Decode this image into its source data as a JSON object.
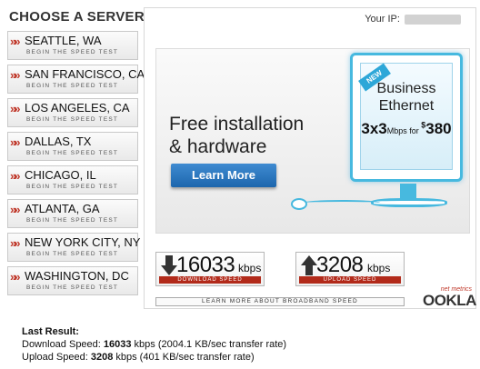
{
  "servers": {
    "title": "CHOOSE A SERVER:",
    "sub_label": "BEGIN THE SPEED TEST",
    "items": [
      {
        "city": "SEATTLE, WA"
      },
      {
        "city": "SAN FRANCISCO, CA"
      },
      {
        "city": "LOS ANGELES, CA"
      },
      {
        "city": "DALLAS, TX"
      },
      {
        "city": "CHICAGO, IL"
      },
      {
        "city": "ATLANTA, GA"
      },
      {
        "city": "NEW YORK CITY, NY"
      },
      {
        "city": "WASHINGTON, DC"
      }
    ]
  },
  "header": {
    "ip_label": "Your IP:"
  },
  "ad": {
    "line1": "Free installation",
    "line2": "& hardware",
    "button": "Learn More",
    "new_tag": "NEW",
    "product1": "Business",
    "product2": "Ethernet",
    "offer_main": "3x3",
    "offer_unit": "Mbps for ",
    "offer_currency": "$",
    "offer_price": "380",
    "accent": "#47b9df"
  },
  "results": {
    "download_value": "16033",
    "download_unit": "kbps",
    "download_label": "DOWNLOAD SPEED",
    "upload_value": "3208",
    "upload_unit": "kbps",
    "upload_label": "UPLOAD SPEED",
    "learn_more": "LEARN MORE ABOUT BROADBAND SPEED",
    "brand_small": "net metrics",
    "brand": "OOKLA",
    "label_color": "#b22a1a"
  },
  "last_result": {
    "heading": "Last Result:",
    "download_prefix": "Download Speed: ",
    "download_value": "16033",
    "download_suffix": " kbps (2004.1 KB/sec transfer rate)",
    "upload_prefix": "Upload Speed: ",
    "upload_value": "3208",
    "upload_suffix": " kbps (401 KB/sec transfer rate)"
  }
}
